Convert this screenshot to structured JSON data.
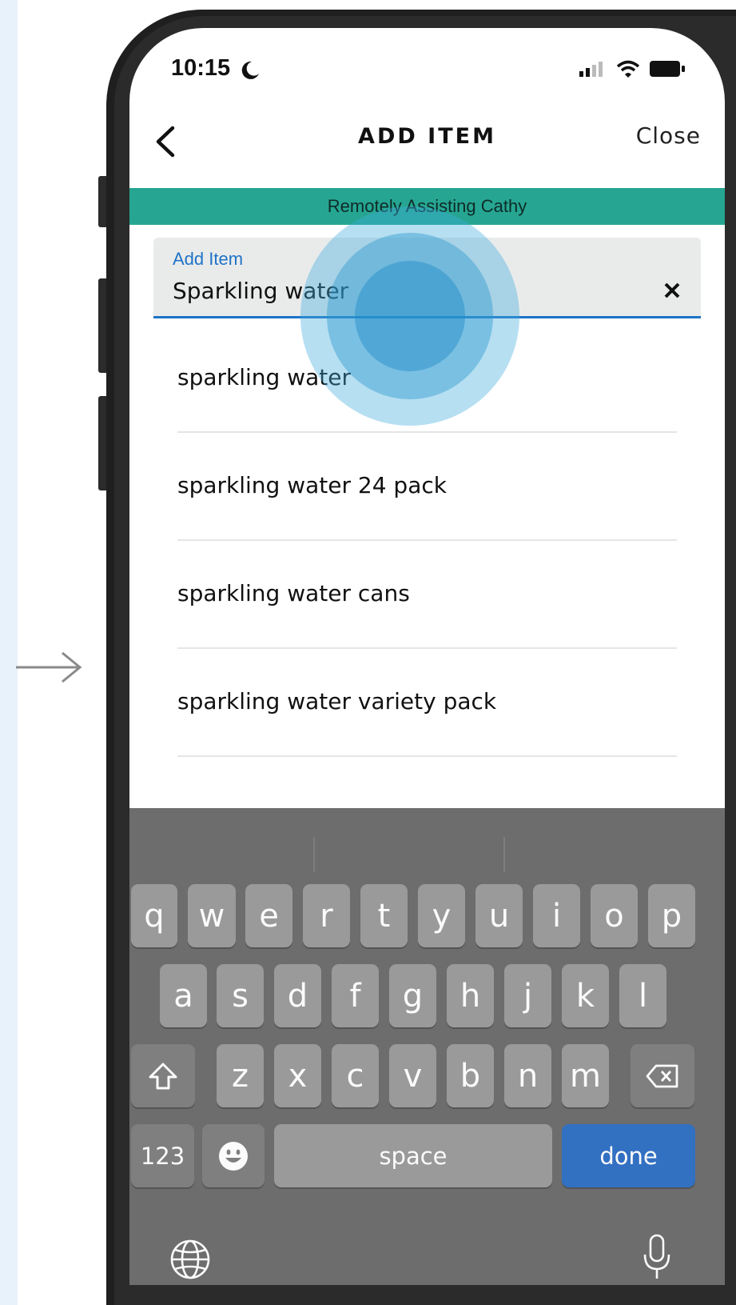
{
  "status_bar": {
    "time": "10:15",
    "icons": [
      "moon-icon",
      "signal-icon",
      "wifi-icon",
      "battery-icon"
    ]
  },
  "nav": {
    "back_icon": "chevron-left-icon",
    "title": "ADD ITEM",
    "close_label": "Close"
  },
  "banner": {
    "text": "Remotely Assisting Cathy",
    "color": "#26a692"
  },
  "field": {
    "label": "Add Item",
    "value": "Sparkling water",
    "clear_icon": "close-icon",
    "accent": "#1f73c7"
  },
  "suggestions": [
    {
      "label": "sparkling water"
    },
    {
      "label": "sparkling water 24 pack"
    },
    {
      "label": "sparkling water cans"
    },
    {
      "label": "sparkling water variety pack"
    }
  ],
  "keyboard": {
    "row1": [
      "q",
      "w",
      "e",
      "r",
      "t",
      "y",
      "u",
      "i",
      "o",
      "p"
    ],
    "row2": [
      "a",
      "s",
      "d",
      "f",
      "g",
      "h",
      "j",
      "k",
      "l"
    ],
    "row3": [
      "z",
      "x",
      "c",
      "v",
      "b",
      "n",
      "m"
    ],
    "shift_icon": "shift-icon",
    "delete_icon": "backspace-icon",
    "numbers_label": "123",
    "emoji_icon": "emoji-icon",
    "space_label": "space",
    "done_label": "done",
    "globe_icon": "globe-icon",
    "mic_icon": "microphone-icon",
    "done_color": "#3270c2"
  }
}
